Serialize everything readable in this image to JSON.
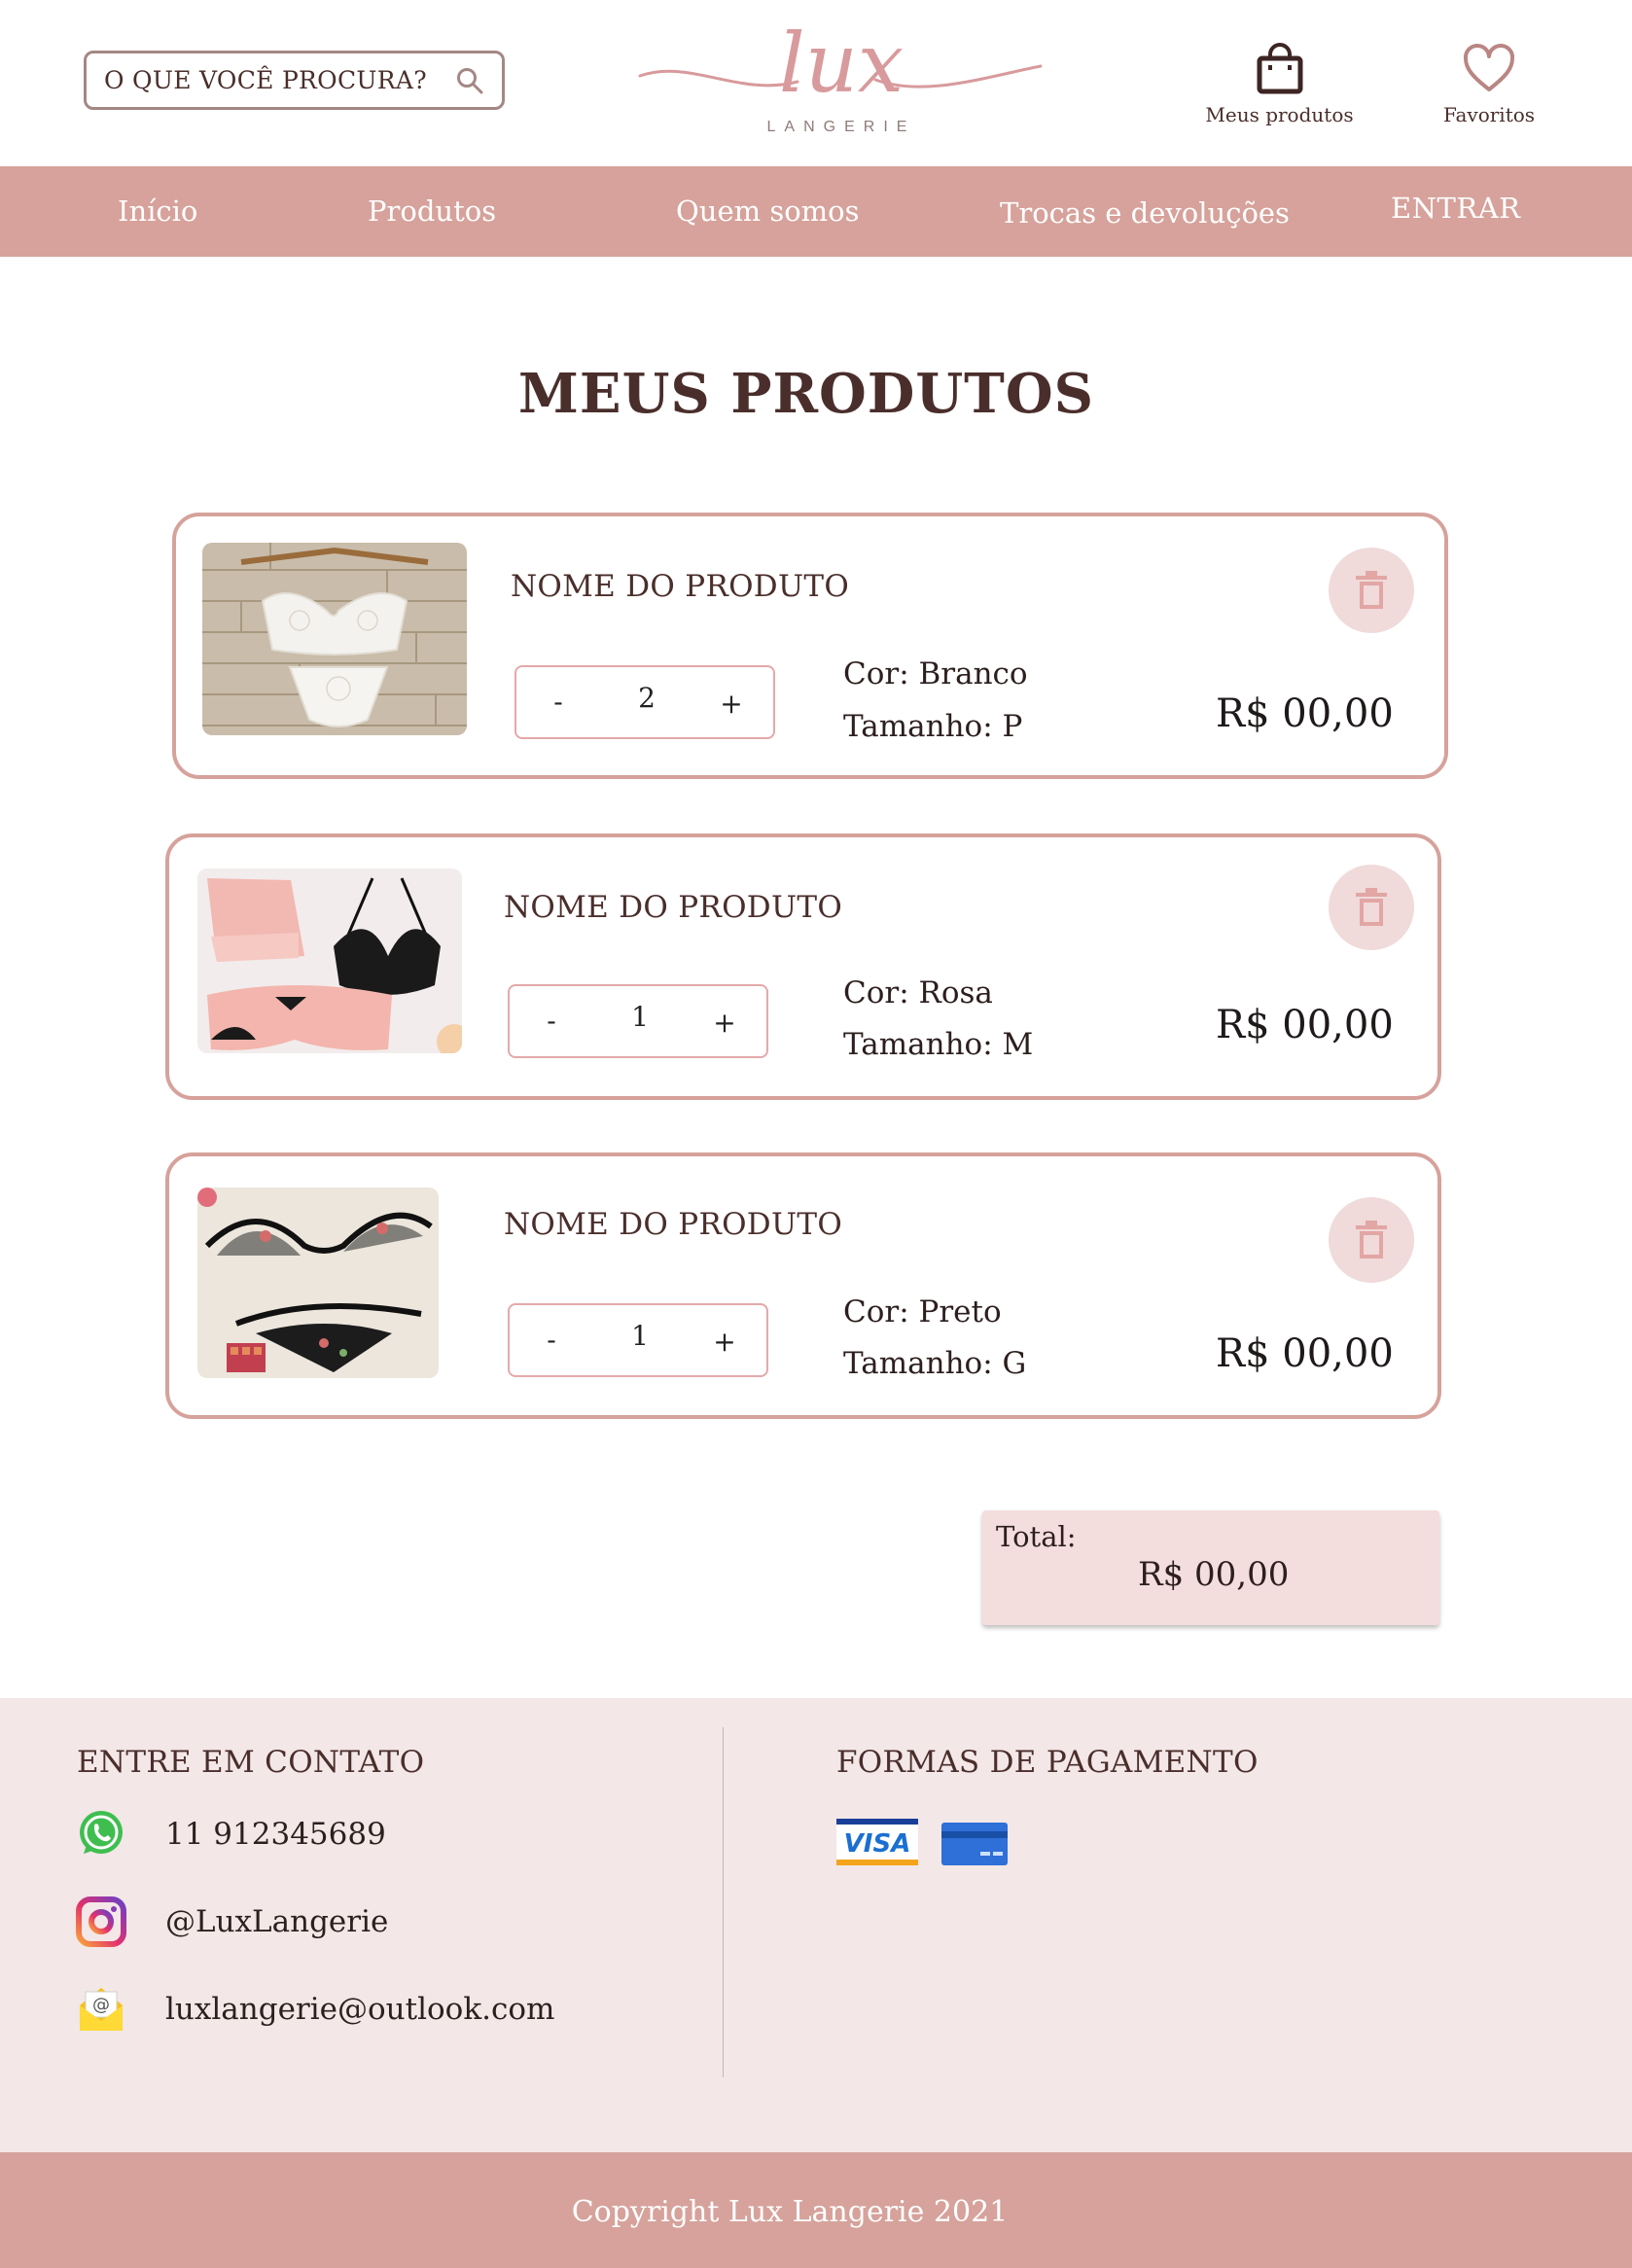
{
  "header": {
    "search_label": "O QUE VOCÊ PROCURA?",
    "logo_text": "lux",
    "logo_subtitle": "LANGERIE",
    "cart_label": "Meus produtos",
    "favorites_label": "Favoritos"
  },
  "nav": {
    "items": [
      "Início",
      "Produtos",
      "Quem somos",
      "Trocas e devoluções",
      "ENTRAR"
    ]
  },
  "main": {
    "title": "MEUS PRODUTOS",
    "products": [
      {
        "name": "NOME DO PRODUTO",
        "qty": "2",
        "color": "Cor: Branco",
        "size": "Tamanho: P",
        "price": "R$ 00,00"
      },
      {
        "name": "NOME DO PRODUTO",
        "qty": "1",
        "color": "Cor: Rosa",
        "size": "Tamanho: M",
        "price": "R$ 00,00"
      },
      {
        "name": "NOME DO PRODUTO",
        "qty": "1",
        "color": "Cor: Preto",
        "size": "Tamanho: G",
        "price": "R$ 00,00"
      }
    ],
    "stepper_minus": "-",
    "stepper_plus": "+",
    "total_label": "Total:",
    "total_value": "R$ 00,00"
  },
  "footer": {
    "contact_title": "ENTRE EM CONTATO",
    "phone": "11 912345689",
    "instagram": "@LuxLangerie",
    "email": "luxlangerie@outlook.com",
    "payment_title": "FORMAS DE PAGAMENTO",
    "visa_text": "VISA",
    "copyright": "Copyright Lux Langerie 2021"
  },
  "colors": {
    "brand_pink": "#d6a29b",
    "text_brown": "#4a2e2b",
    "footer_bg": "#f3e7e7",
    "total_bg": "#f3dedd"
  }
}
